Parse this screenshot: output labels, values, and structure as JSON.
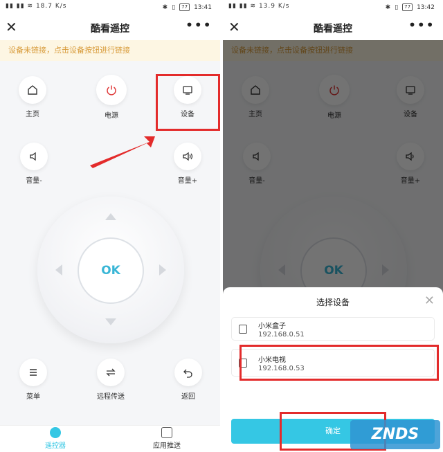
{
  "status_left": {
    "net": "18.7 K/s",
    "time": "13:41",
    "battery": "77"
  },
  "status_right": {
    "net": "13.9 K/s",
    "time": "13:42",
    "battery": "77"
  },
  "app": {
    "title": "酷看遥控"
  },
  "notice": "设备未链接，点击设备按钮进行链接",
  "buttons": {
    "home": "主页",
    "power": "电源",
    "device": "设备",
    "vol_down": "音量-",
    "vol_up": "音量+",
    "ok": "OK",
    "menu": "菜单",
    "remote_transfer": "远程传送",
    "back": "返回"
  },
  "tabs": {
    "remote": "遥控器",
    "app_push": "应用推送"
  },
  "sheet": {
    "title": "选择设备",
    "devices": [
      {
        "name": "小米盒子",
        "ip": "192.168.0.51"
      },
      {
        "name": "小米电视",
        "ip": "192.168.0.53"
      }
    ],
    "confirm": "确定"
  },
  "watermark": "ZNDS",
  "colors": {
    "accent": "#35c7e4",
    "ok_text": "#39b6d6",
    "notice_text": "#d89b3a",
    "highlight": "#e32b2b"
  }
}
